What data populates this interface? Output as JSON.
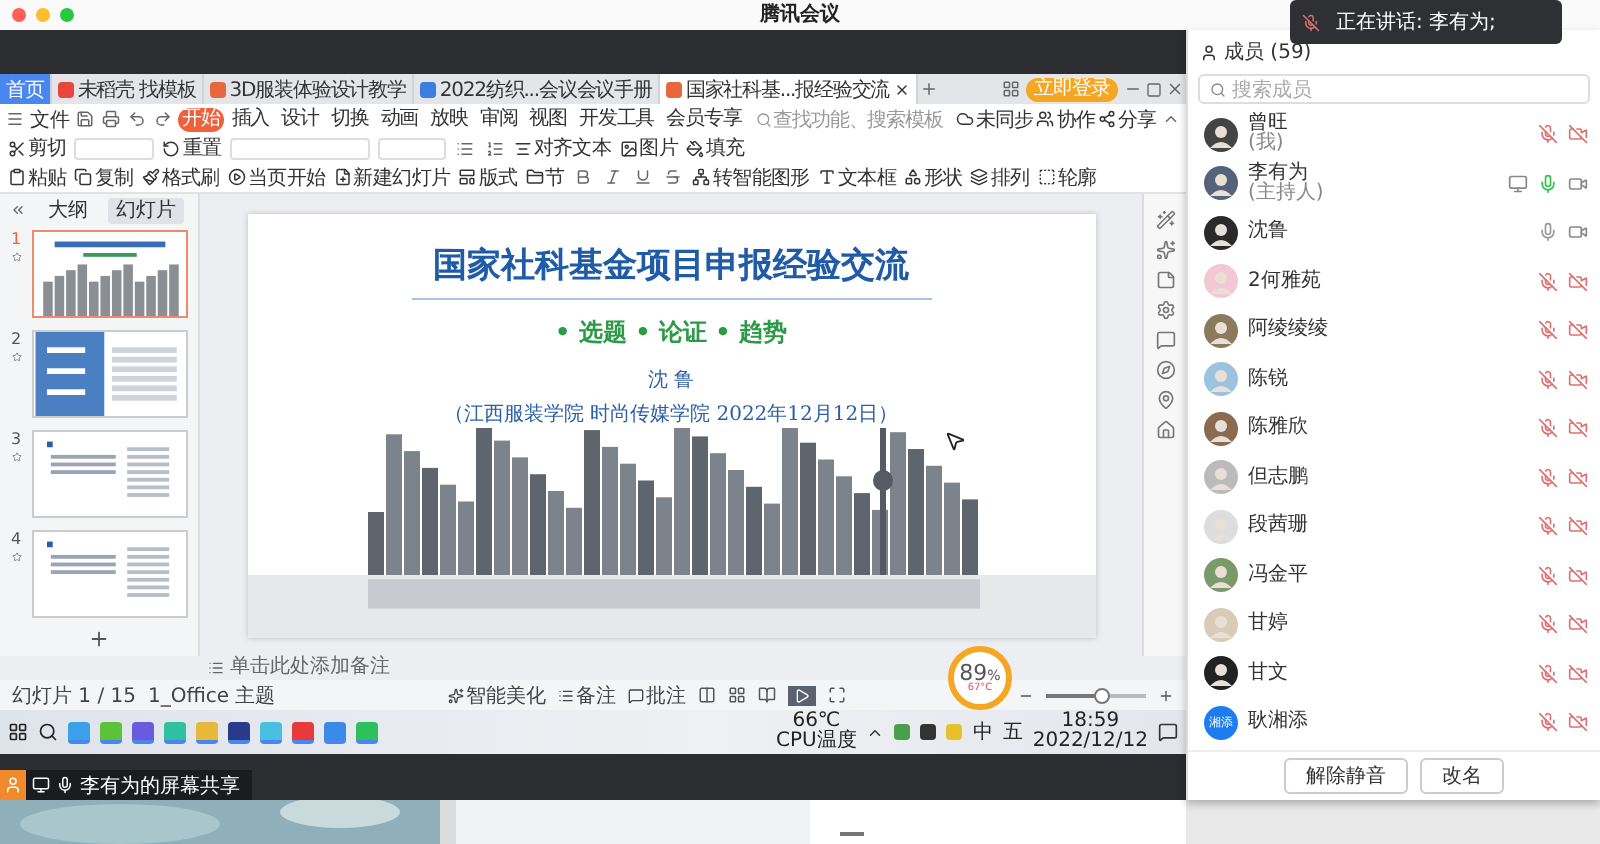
{
  "app_title": "腾讯会议",
  "wps": {
    "doc_tabs": [
      {
        "label": "首页",
        "kind": "home",
        "selected": false
      },
      {
        "label": "未稻壳 找模板",
        "kind": "docer",
        "selected": false
      },
      {
        "label": "3D服装体验设计教学",
        "kind": "ppt",
        "selected": false
      },
      {
        "label": "2022纺织...会议会议手册",
        "kind": "word",
        "selected": false
      },
      {
        "label": "国家社科基...报经验交流",
        "kind": "ppt",
        "selected": true
      }
    ],
    "login_button": "立即登录",
    "file_menu": "文件",
    "ribbon_tabs": [
      {
        "label": "开始",
        "selected": true
      },
      {
        "label": "插入",
        "selected": false
      },
      {
        "label": "设计",
        "selected": false
      },
      {
        "label": "切换",
        "selected": false
      },
      {
        "label": "动画",
        "selected": false
      },
      {
        "label": "放映",
        "selected": false
      },
      {
        "label": "审阅",
        "selected": false
      },
      {
        "label": "视图",
        "selected": false
      },
      {
        "label": "开发工具",
        "selected": false
      },
      {
        "label": "会员专享",
        "selected": false
      }
    ],
    "search_placeholder": "查找功能、搜索模板",
    "cloud_actions": [
      "未同步",
      "协作",
      "分享"
    ],
    "ribbon_row1": [
      "剪切",
      "重置",
      "对齐文本",
      "图片",
      "填充"
    ],
    "ribbon_row2": [
      "粘贴",
      "复制",
      "格式刷",
      "当页开始",
      "新建幻灯片",
      "版式",
      "节",
      "转智能图形",
      "文本框",
      "形状",
      "排列",
      "轮廓"
    ],
    "pane_tabs": [
      {
        "label": "大纲",
        "selected": false
      },
      {
        "label": "幻灯片",
        "selected": true
      }
    ],
    "thumbnails": [
      {
        "number": "1",
        "kind": "title",
        "selected": true
      },
      {
        "number": "2",
        "kind": "list",
        "selected": false
      },
      {
        "number": "3",
        "kind": "text",
        "selected": false
      },
      {
        "number": "4",
        "kind": "text",
        "selected": false
      }
    ],
    "slide": {
      "title": "国家社科基金项目申报经验交流",
      "keywords": "• 选题 • 论证 • 趋势",
      "author": "沈 鲁",
      "affiliation": "（江西服装学院 时尚传媒学院 2022年12月12日）"
    },
    "notes_placeholder": "单击此处添加备注",
    "status": {
      "slide_count": "幻灯片 1 / 15",
      "theme": "1_Office 主题",
      "beautify": "智能美化",
      "notes": "备注",
      "comments": "批注",
      "zoom_slider": {
        "level": 0.55
      }
    },
    "gauge": {
      "value": "89",
      "unit": "%",
      "temp": "67°C"
    }
  },
  "taskbar": {
    "cpu_temp": "66℃",
    "cpu_label": "CPU温度",
    "ime": "中",
    "ime_mode": "五",
    "time": "18:59",
    "date": "2022/12/12"
  },
  "share_bar": {
    "label": "李有为的屏幕共享"
  },
  "speaking_toast": "正在讲话: 李有为;",
  "members_panel": {
    "title": "成员 (59)",
    "search_placeholder": "搜索成员",
    "members": [
      {
        "name": "曾旺",
        "role": "(我)",
        "muted": true,
        "camera_on": false,
        "sharing": false
      },
      {
        "name": "李有为",
        "role": "(主持人)",
        "muted": false,
        "speaking": true,
        "camera_on": true,
        "sharing": true
      },
      {
        "name": "沈鲁",
        "muted": false,
        "speaking": false,
        "camera_on": true,
        "sharing": false
      },
      {
        "name": "2何雅苑",
        "muted": true,
        "camera_on": false,
        "sharing": false
      },
      {
        "name": "阿绫绫绫",
        "muted": true,
        "camera_on": false,
        "sharing": false
      },
      {
        "name": "陈锐",
        "muted": true,
        "camera_on": false,
        "sharing": false
      },
      {
        "name": "陈雅欣",
        "muted": true,
        "camera_on": false,
        "sharing": false
      },
      {
        "name": "但志鹏",
        "muted": true,
        "camera_on": false,
        "sharing": false
      },
      {
        "name": "段茜珊",
        "muted": true,
        "camera_on": false,
        "sharing": false
      },
      {
        "name": "冯金平",
        "muted": true,
        "camera_on": false,
        "sharing": false
      },
      {
        "name": "甘婷",
        "muted": true,
        "camera_on": false,
        "sharing": false
      },
      {
        "name": "甘文",
        "muted": true,
        "camera_on": false,
        "sharing": false
      },
      {
        "name": "耿湘添",
        "initials": "湘添",
        "muted": true,
        "camera_on": false,
        "sharing": false
      }
    ],
    "buttons": [
      "解除静音",
      "改名"
    ]
  }
}
